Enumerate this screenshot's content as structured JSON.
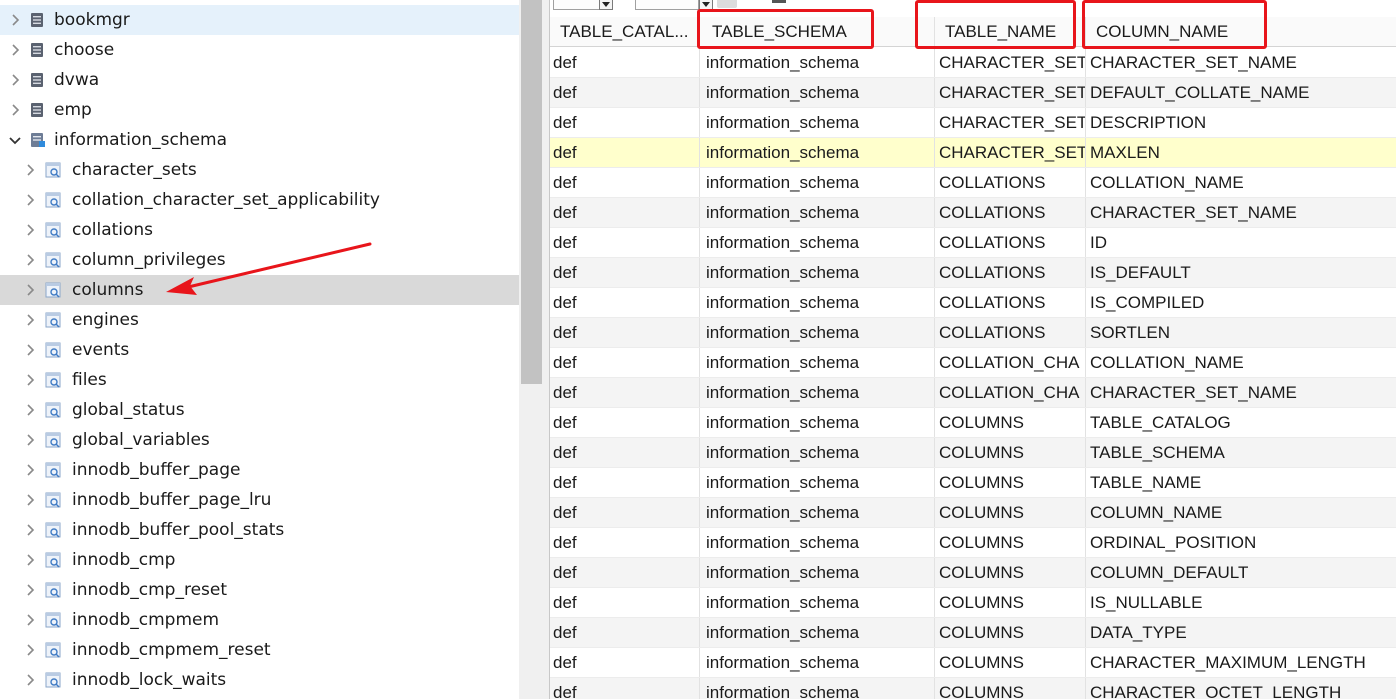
{
  "tree": {
    "databases_before": [
      {
        "label": "bookmgr",
        "expanded": false
      },
      {
        "label": "choose",
        "expanded": false
      },
      {
        "label": "dvwa",
        "expanded": false
      },
      {
        "label": "emp",
        "expanded": false
      }
    ],
    "expanded_db": {
      "label": "information_schema",
      "expanded": true
    },
    "tables": [
      {
        "label": "character_sets"
      },
      {
        "label": "collation_character_set_applicability"
      },
      {
        "label": "collations"
      },
      {
        "label": "column_privileges"
      },
      {
        "label": "columns",
        "selected": true
      },
      {
        "label": "engines"
      },
      {
        "label": "events"
      },
      {
        "label": "files"
      },
      {
        "label": "global_status"
      },
      {
        "label": "global_variables"
      },
      {
        "label": "innodb_buffer_page"
      },
      {
        "label": "innodb_buffer_page_lru"
      },
      {
        "label": "innodb_buffer_pool_stats"
      },
      {
        "label": "innodb_cmp"
      },
      {
        "label": "innodb_cmp_reset"
      },
      {
        "label": "innodb_cmpmem"
      },
      {
        "label": "innodb_cmpmem_reset"
      },
      {
        "label": "innodb_lock_waits"
      }
    ]
  },
  "grid": {
    "columns": [
      "TABLE_CATAL...",
      "TABLE_SCHEMA",
      "TABLE_NAME",
      "COLUMN_NAME"
    ],
    "rows": [
      [
        "def",
        "information_schema",
        "CHARACTER_SET",
        "CHARACTER_SET_NAME"
      ],
      [
        "def",
        "information_schema",
        "CHARACTER_SET",
        "DEFAULT_COLLATE_NAME"
      ],
      [
        "def",
        "information_schema",
        "CHARACTER_SET",
        "DESCRIPTION"
      ],
      [
        "def",
        "information_schema",
        "CHARACTER_SET",
        "MAXLEN"
      ],
      [
        "def",
        "information_schema",
        "COLLATIONS",
        "COLLATION_NAME"
      ],
      [
        "def",
        "information_schema",
        "COLLATIONS",
        "CHARACTER_SET_NAME"
      ],
      [
        "def",
        "information_schema",
        "COLLATIONS",
        "ID"
      ],
      [
        "def",
        "information_schema",
        "COLLATIONS",
        "IS_DEFAULT"
      ],
      [
        "def",
        "information_schema",
        "COLLATIONS",
        "IS_COMPILED"
      ],
      [
        "def",
        "information_schema",
        "COLLATIONS",
        "SORTLEN"
      ],
      [
        "def",
        "information_schema",
        "COLLATION_CHA",
        "COLLATION_NAME"
      ],
      [
        "def",
        "information_schema",
        "COLLATION_CHA",
        "CHARACTER_SET_NAME"
      ],
      [
        "def",
        "information_schema",
        "COLUMNS",
        "TABLE_CATALOG"
      ],
      [
        "def",
        "information_schema",
        "COLUMNS",
        "TABLE_SCHEMA"
      ],
      [
        "def",
        "information_schema",
        "COLUMNS",
        "TABLE_NAME"
      ],
      [
        "def",
        "information_schema",
        "COLUMNS",
        "COLUMN_NAME"
      ],
      [
        "def",
        "information_schema",
        "COLUMNS",
        "ORDINAL_POSITION"
      ],
      [
        "def",
        "information_schema",
        "COLUMNS",
        "COLUMN_DEFAULT"
      ],
      [
        "def",
        "information_schema",
        "COLUMNS",
        "IS_NULLABLE"
      ],
      [
        "def",
        "information_schema",
        "COLUMNS",
        "DATA_TYPE"
      ],
      [
        "def",
        "information_schema",
        "COLUMNS",
        "CHARACTER_MAXIMUM_LENGTH"
      ],
      [
        "def",
        "information_schema",
        "COLUMNS",
        "CHARACTER_OCTET_LENGTH"
      ]
    ],
    "highlighted_row": 3
  },
  "annotations": {
    "highlight_color": "#e8151b",
    "arrow_target": "columns"
  },
  "colors": {
    "selected_row": "#d9d9d9",
    "highlighted_grid_row": "#ffffcc",
    "alt_row": "#f4f4f4"
  }
}
